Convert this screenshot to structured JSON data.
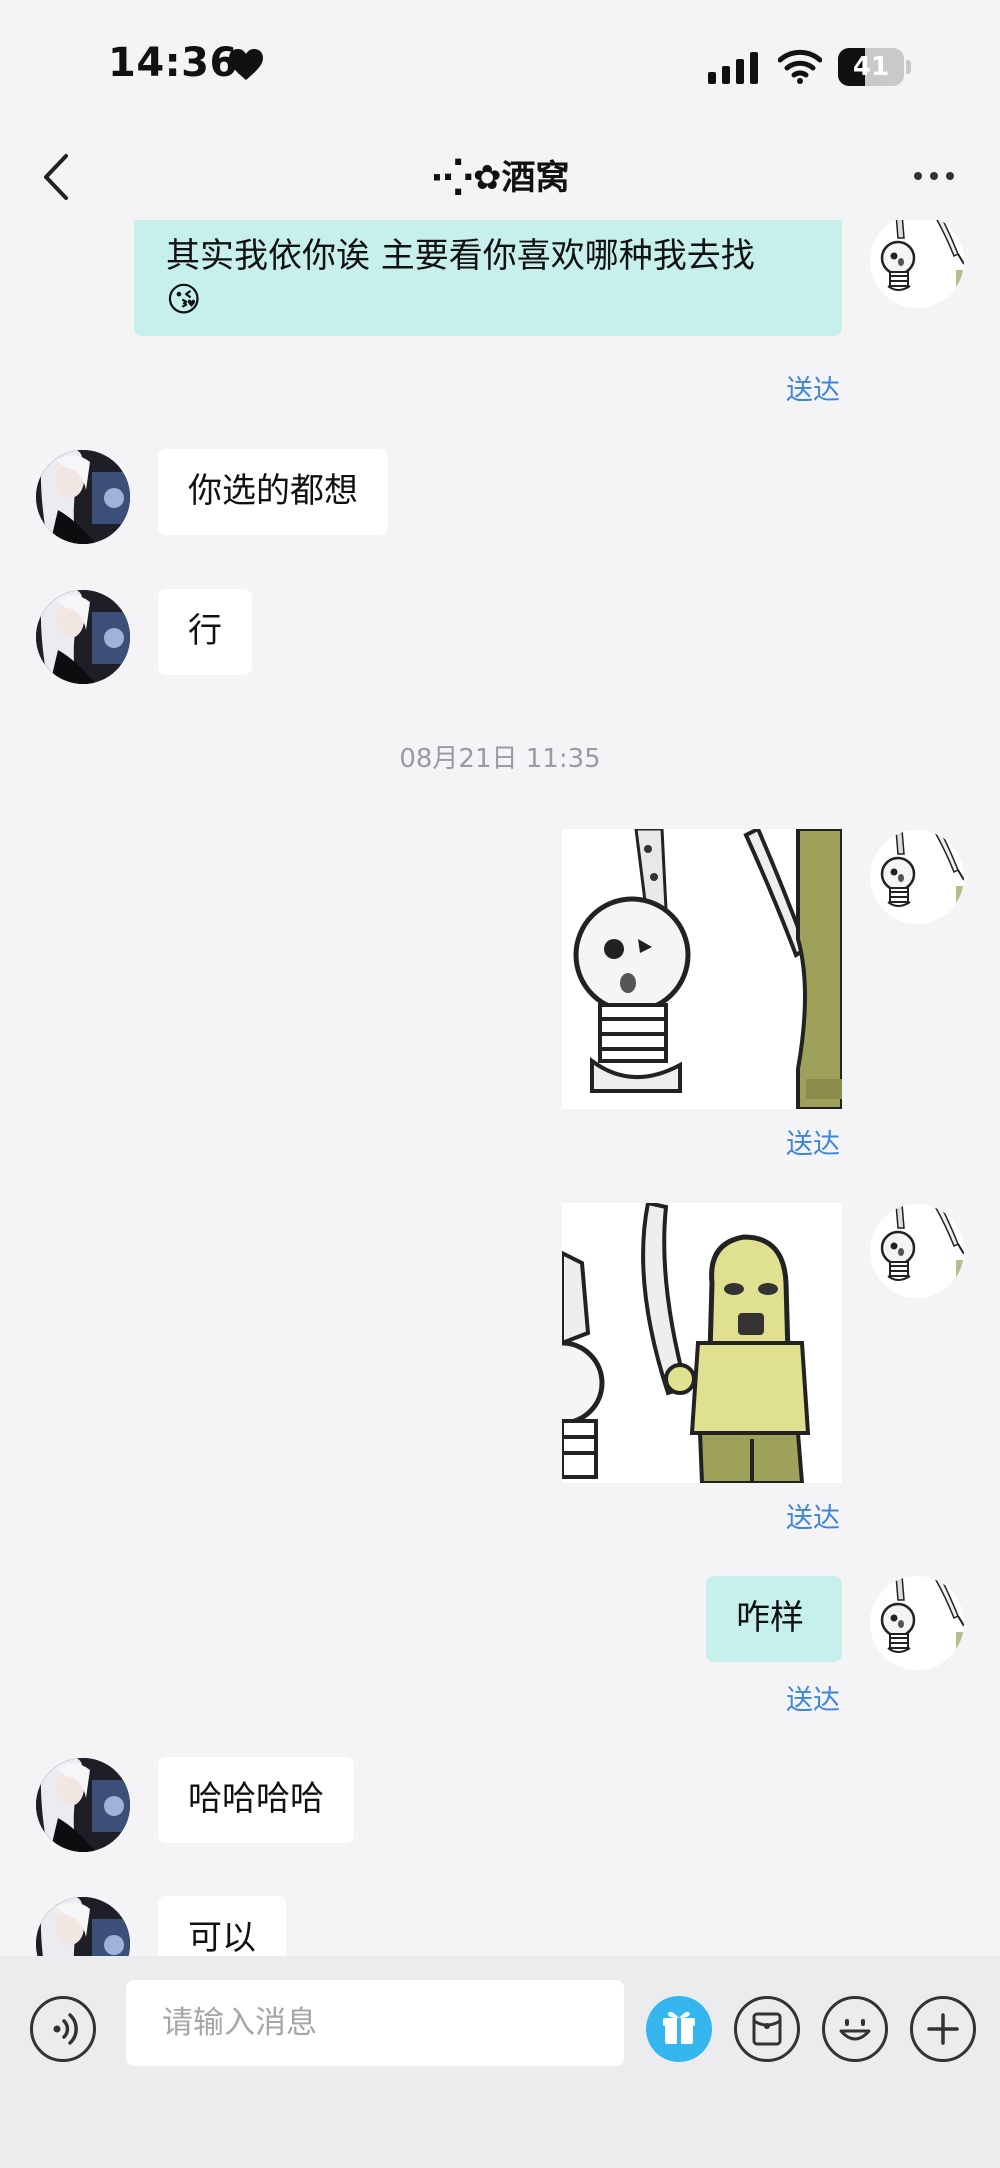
{
  "status_bar": {
    "time": "14:36",
    "battery": "41",
    "battery_level": 0.41
  },
  "header": {
    "title": "酒窝",
    "title_prefix": "·⁛✿"
  },
  "messages": {
    "m1": {
      "text": "其实我依你诶  主要看你喜欢哪种我去找",
      "emoji": "😘",
      "status": "送达"
    },
    "m2": {
      "text": "你选的都想"
    },
    "m3": {
      "text": "行"
    },
    "timestamp": "08月21日 11:35",
    "m4": {
      "status": "送达"
    },
    "m5": {
      "status": "送达"
    },
    "m6": {
      "text": "咋样",
      "status": "送达"
    },
    "m7": {
      "text": "哈哈哈哈"
    },
    "m8": {
      "text": "可以"
    }
  },
  "input": {
    "placeholder": "请输入消息"
  },
  "colors": {
    "outgoing_bubble": "#c7f0ec",
    "incoming_bubble": "#ffffff",
    "status_text": "#3f86d8",
    "gift_button": "#35b6ee",
    "background": "#f4f4f6"
  },
  "icons": [
    "heart-icon",
    "signal-icon",
    "wifi-icon",
    "battery-icon",
    "back-arrow-icon",
    "more-icon",
    "voice-icon",
    "gift-icon",
    "red-packet-icon",
    "emoji-icon",
    "plus-icon"
  ]
}
